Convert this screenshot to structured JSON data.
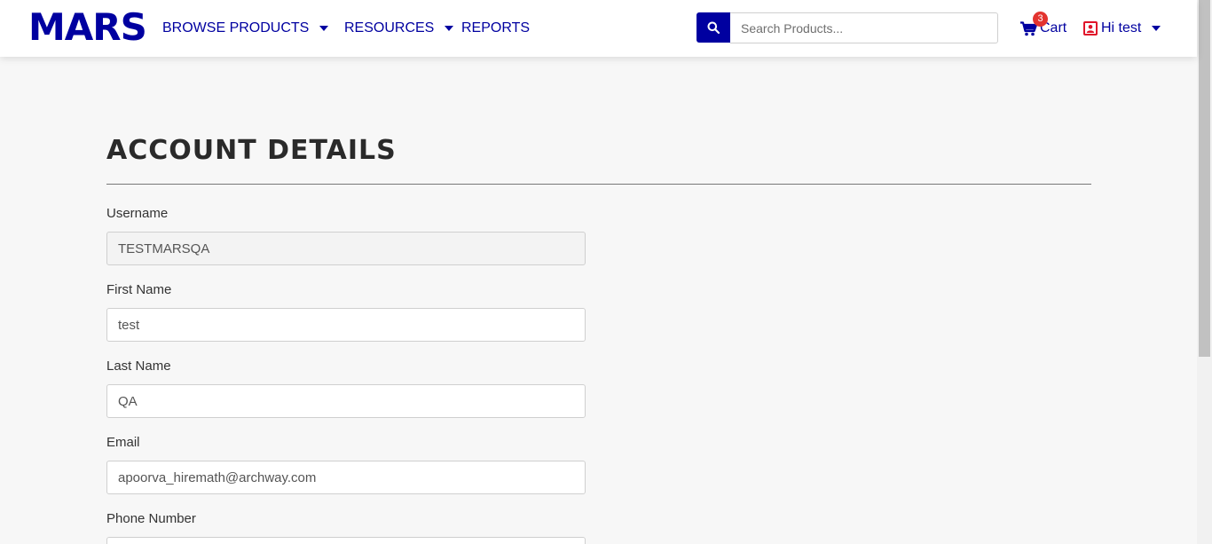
{
  "brand": {
    "logo_text": "MARS",
    "accent_color": "#0000a0"
  },
  "nav": {
    "browse_products": "BROWSE PRODUCTS",
    "resources": "RESOURCES",
    "reports": "REPORTS"
  },
  "search": {
    "placeholder": "Search Products...",
    "value": ""
  },
  "cart": {
    "label": "Cart",
    "count": "3"
  },
  "user": {
    "greeting": "Hi test"
  },
  "page": {
    "title": "ACCOUNT DETAILS"
  },
  "form": {
    "username": {
      "label": "Username",
      "value": "TESTMARSQA"
    },
    "first_name": {
      "label": "First Name",
      "value": "test"
    },
    "last_name": {
      "label": "Last Name",
      "value": "QA"
    },
    "email": {
      "label": "Email",
      "value": "apoorva_hiremath@archway.com"
    },
    "phone": {
      "label": "Phone Number",
      "value": ""
    }
  }
}
